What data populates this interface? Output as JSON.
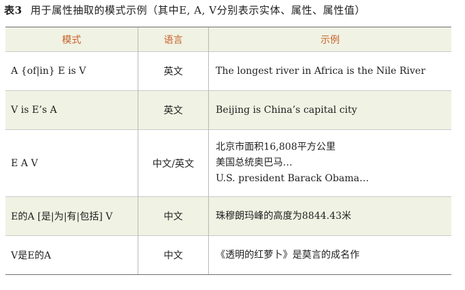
{
  "caption": {
    "number": "表3",
    "text": "用于属性抽取的模式示例（其中E, A, V分别表示实体、属性、属性值）"
  },
  "table": {
    "headers": [
      "模式",
      "语言",
      "示例"
    ],
    "rows": [
      {
        "pattern": "A {of|in} E is V",
        "language": "英文",
        "examples": [
          "The longest river in Africa is the Nile River"
        ]
      },
      {
        "pattern": "V is E’s A",
        "language": "英文",
        "examples": [
          "Beijing is China’s capital city"
        ]
      },
      {
        "pattern": "E A V",
        "language": "中文/英文",
        "examples": [
          "北京市面积16,808平方公里",
          "美国总统奥巴马…",
          "U.S. president Barack Obama…"
        ]
      },
      {
        "pattern": "E的A [是|为|有|包括] V",
        "language": "中文",
        "examples": [
          "珠穆朗玛峰的高度为8844.43米"
        ]
      },
      {
        "pattern": "V是E的A",
        "language": "中文",
        "examples": [
          "《透明的红萝卜》是莫言的成名作"
        ]
      }
    ]
  }
}
